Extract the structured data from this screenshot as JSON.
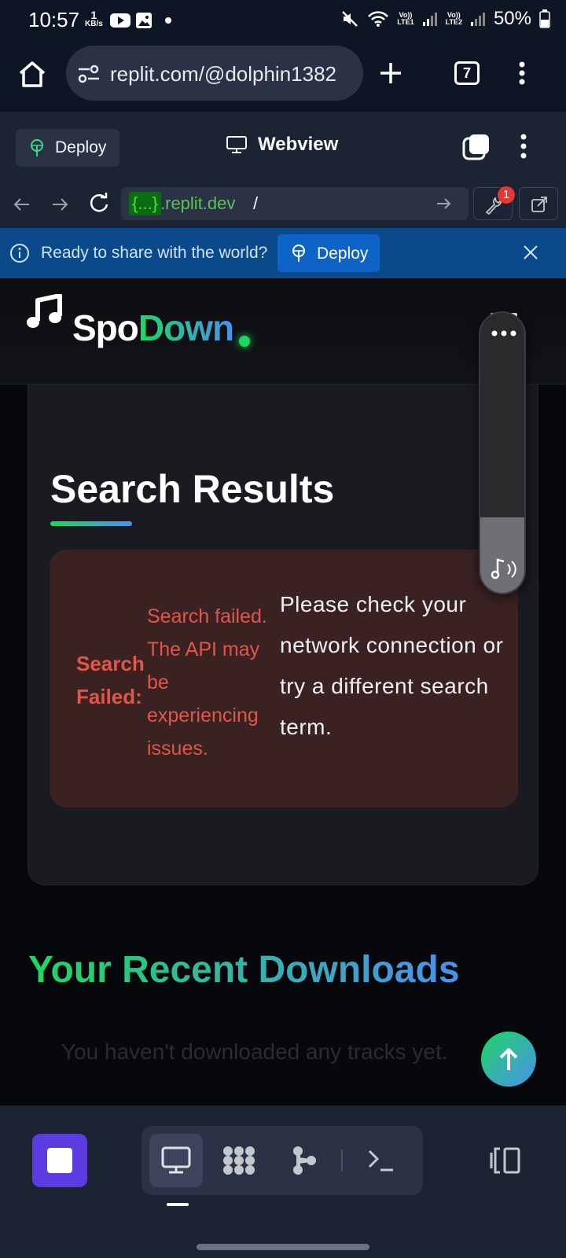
{
  "status_bar": {
    "time": "10:57",
    "net_speed_value": "1",
    "net_speed_unit": "KB/s",
    "sim1_volte": "Vo))",
    "sim1_lte": "LTE1",
    "sim2_volte": "Vo))",
    "sim2_lte": "LTE2",
    "battery": "50%"
  },
  "browser": {
    "url": "replit.com/@dolphin1382",
    "tab_count": "7"
  },
  "replit_header": {
    "deploy_label": "Deploy",
    "title": "Webview"
  },
  "webview_nav": {
    "url_hint": "{...}",
    "url_domain": ".replit.dev",
    "url_path": "/",
    "devtools_badge": "1"
  },
  "banner": {
    "message": "Ready to share with the world?",
    "deploy_label": "Deploy"
  },
  "app": {
    "logo_part1": "Spo",
    "logo_part2": "Down",
    "results_title": "Search Results",
    "error_label": "Search Failed:",
    "error_detail": "Search failed. The API may be experiencing issues.",
    "error_help": "Please check your network connection or try a different search term.",
    "recent_title": "Your Recent Downloads",
    "recent_empty": "You haven't downloaded any tracks yet."
  },
  "audio_widget": {
    "level_fraction": 0.27
  },
  "colors": {
    "brand_green": "#1ed760",
    "brand_blue": "#4b8ff0",
    "error_red": "#e35546",
    "replit_purple": "#5b3ce0"
  }
}
